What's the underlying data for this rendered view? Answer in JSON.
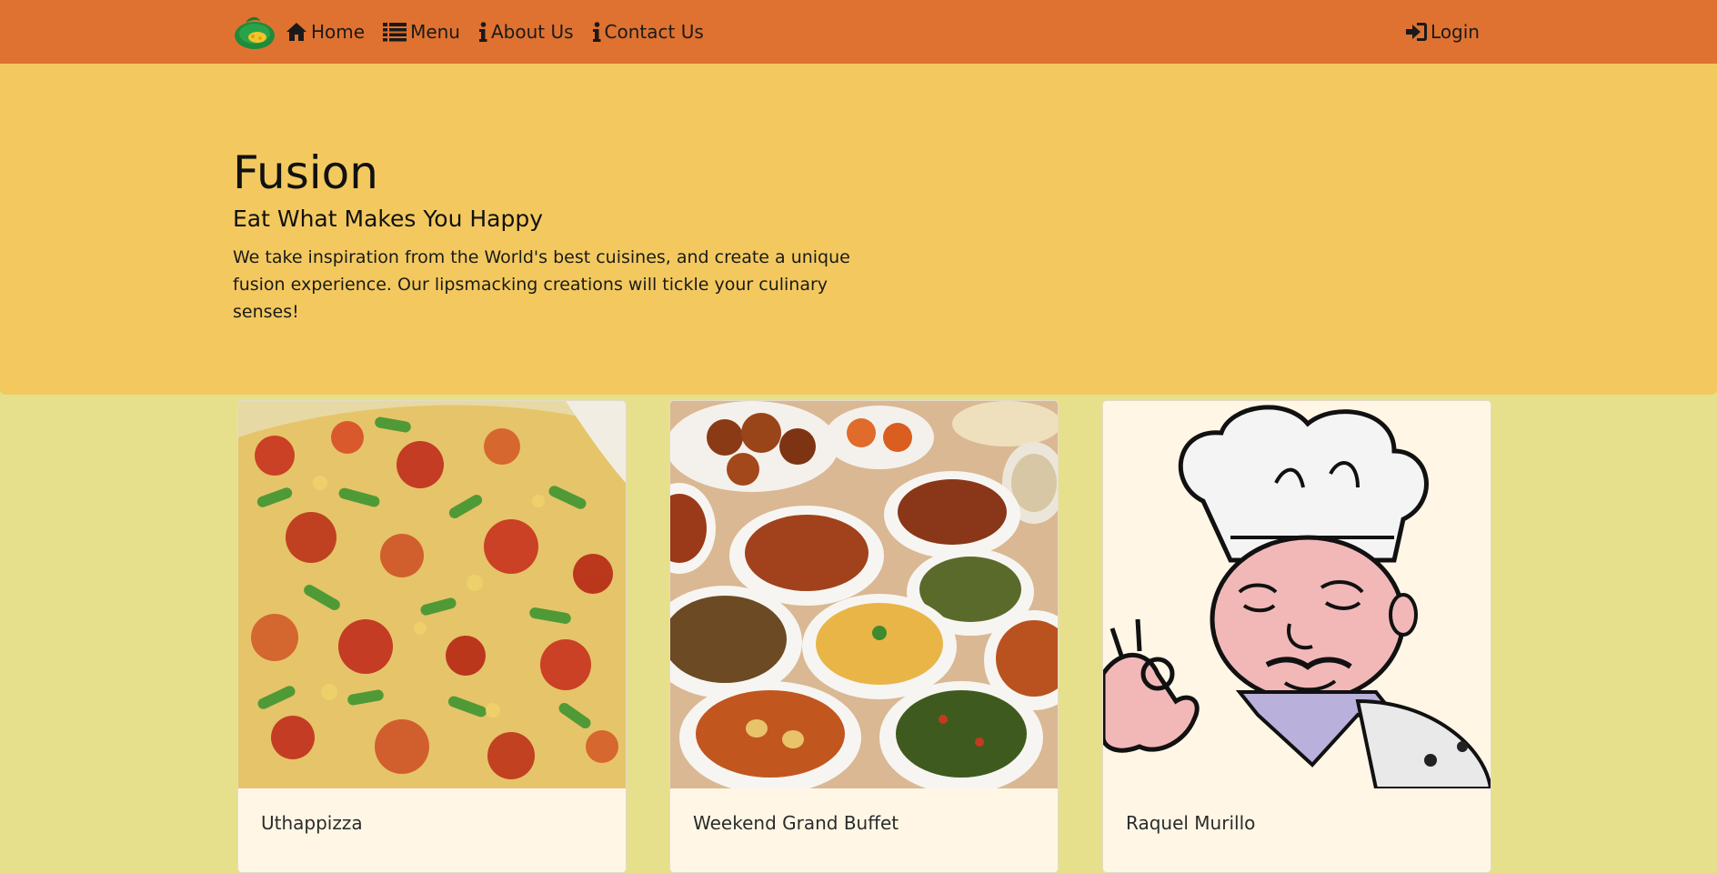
{
  "navbar": {
    "brand_icon": "fusion-logo",
    "links": [
      {
        "label": "Home",
        "icon": "home-icon"
      },
      {
        "label": "Menu",
        "icon": "list-icon"
      },
      {
        "label": "About Us",
        "icon": "info-icon"
      },
      {
        "label": "Contact Us",
        "icon": "info-icon"
      }
    ],
    "login": {
      "label": "Login",
      "icon": "sign-in-icon"
    },
    "color": "#df7230"
  },
  "hero": {
    "title": "Fusion",
    "subtitle": "Eat What Makes You Happy",
    "text": "We take inspiration from the World's best cuisines, and create a unique fusion experience. Our lipsmacking creations will tickle your culinary senses!",
    "color": "#f3c95f"
  },
  "cards": [
    {
      "title": "Uthappizza",
      "image": "pizza-photo"
    },
    {
      "title": "Weekend Grand Buffet",
      "image": "buffet-photo"
    },
    {
      "title": "Raquel Murillo",
      "image": "chef-illustration"
    }
  ],
  "page_background": "#e6e08c"
}
